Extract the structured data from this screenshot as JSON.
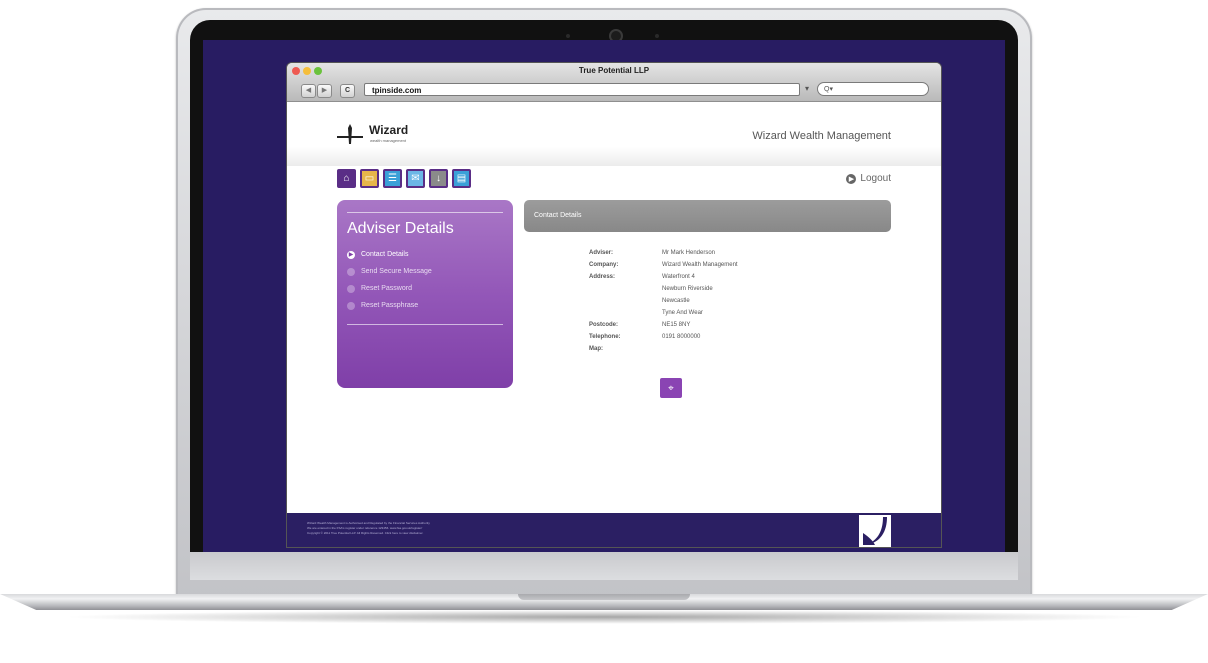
{
  "window": {
    "title": "True Potential LLP",
    "url": "tpinside.com",
    "search_glyph": "Q▾"
  },
  "header": {
    "logo": "Wizard",
    "logo_sub": "wealth management",
    "brand": "Wizard Wealth Management",
    "logout": "Logout"
  },
  "toolbar_icons": [
    {
      "icon": "home-icon",
      "color": "#5a2d86",
      "glyph": "⌂"
    },
    {
      "icon": "briefcase-icon",
      "color": "#e7b64a",
      "glyph": "▭"
    },
    {
      "icon": "contact-card-icon",
      "color": "#3aa0d8",
      "glyph": "☰"
    },
    {
      "icon": "mail-icon",
      "color": "#6cb6e6",
      "glyph": "✉"
    },
    {
      "icon": "download-icon",
      "color": "#8a8a8a",
      "glyph": "↓"
    },
    {
      "icon": "document-icon",
      "color": "#3aa0d8",
      "glyph": "▤"
    }
  ],
  "sidebar": {
    "title": "Adviser Details",
    "items": [
      {
        "label": "Contact Details",
        "active": true
      },
      {
        "label": "Send Secure Message",
        "active": false
      },
      {
        "label": "Reset Password",
        "active": false
      },
      {
        "label": "Reset Passphrase",
        "active": false
      }
    ]
  },
  "content": {
    "header": "Contact Details",
    "fields": [
      {
        "label": "Adviser:",
        "value": "Mr Mark Henderson"
      },
      {
        "label": "Company:",
        "value": "Wizard Wealth Management"
      },
      {
        "label": "Address:",
        "value": "Waterfront 4"
      },
      {
        "label": "",
        "value": "Newburn Riverside"
      },
      {
        "label": "",
        "value": "Newcastle"
      },
      {
        "label": "",
        "value": "Tyne And Wear"
      },
      {
        "label": "Postcode:",
        "value": "NE15 8NY"
      },
      {
        "label": "Telephone:",
        "value": "0191 8000000"
      },
      {
        "label": "Map:",
        "value": ""
      }
    ]
  },
  "footer": {
    "lines": [
      "Wizard Wealth Management is Authorised and Regulated by the Financial Services Authority",
      "We are entered in the FSA's register under reference 123456. www.fsa.gov.uk/register/",
      "Copyright © 2011 True Potential LLP. All Rights Reserved. Click here to view disclaimer."
    ]
  },
  "colors": {
    "screen_bg": "#281c62",
    "sidebar_purple": "#9357b8",
    "footer_bg": "#2b1f63"
  }
}
